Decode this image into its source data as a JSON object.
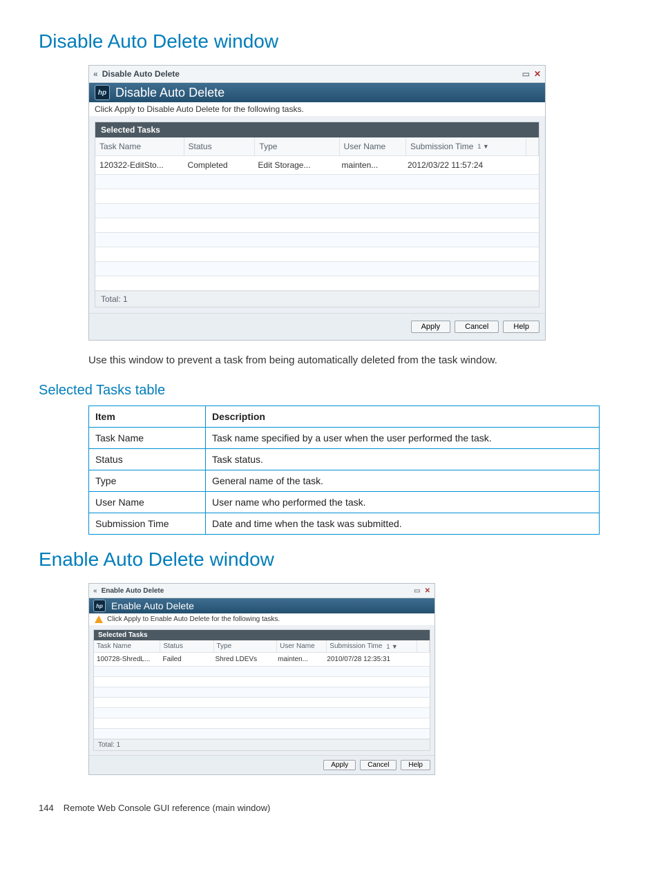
{
  "section1": {
    "title": "Disable Auto Delete window",
    "win": {
      "title": "Disable Auto Delete",
      "header": "Disable Auto Delete",
      "hint": "Click Apply to Disable Auto Delete for the following tasks.",
      "panel": "Selected Tasks",
      "cols": {
        "tn": "Task Name",
        "st": "Status",
        "ty": "Type",
        "un": "User Name",
        "sub": "Submission Time",
        "sort": "1 ▼"
      },
      "row": {
        "tn": "120322-EditSto...",
        "st": "Completed",
        "ty": "Edit Storage...",
        "un": "mainten...",
        "sub": "2012/03/22 11:57:24"
      },
      "total": "Total: 1",
      "buttons": {
        "apply": "Apply",
        "cancel": "Cancel",
        "help": "Help"
      }
    },
    "caption": "Use this window to prevent a task from being automatically deleted from the task window.",
    "subheading": "Selected Tasks table",
    "table": {
      "h1": "Item",
      "h2": "Description",
      "rows": [
        {
          "i": "Task Name",
          "d": "Task name specified by a user when the user performed the task."
        },
        {
          "i": "Status",
          "d": "Task status."
        },
        {
          "i": "Type",
          "d": "General name of the task."
        },
        {
          "i": "User Name",
          "d": "User name who performed the task."
        },
        {
          "i": "Submission Time",
          "d": "Date and time when the task was submitted."
        }
      ]
    }
  },
  "section2": {
    "title": "Enable Auto Delete window",
    "win": {
      "title": "Enable Auto Delete",
      "header": "Enable Auto Delete",
      "hint": "Click Apply to Enable Auto Delete for the following tasks.",
      "panel": "Selected Tasks",
      "cols": {
        "tn": "Task Name",
        "st": "Status",
        "ty": "Type",
        "un": "User Name",
        "sub": "Submission Time",
        "sort": "1 ▼"
      },
      "row": {
        "tn": "100728-ShredL...",
        "st": "Failed",
        "ty": "Shred LDEVs",
        "un": "mainten...",
        "sub": "2010/07/28 12:35:31"
      },
      "total": "Total: 1",
      "buttons": {
        "apply": "Apply",
        "cancel": "Cancel",
        "help": "Help"
      }
    }
  },
  "footer": {
    "page": "144",
    "ref": "Remote Web Console GUI reference (main window)"
  }
}
